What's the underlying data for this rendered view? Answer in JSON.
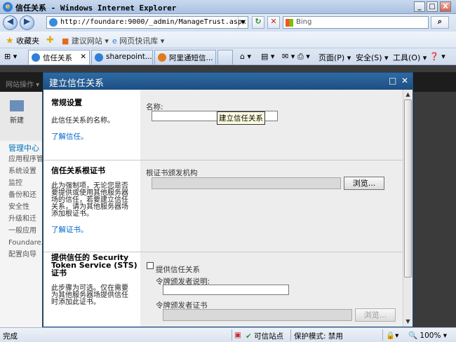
{
  "window": {
    "title": "信任关系 - Windows Internet Explorer",
    "minimize": "_",
    "restore": "□",
    "close": "X"
  },
  "addressbar": {
    "back": "◀",
    "forward": "▶",
    "url": "http://foundare:9000/_admin/ManageTrust.aspx",
    "refresh": "↻",
    "stop": "✕",
    "search_placeholder": "Bing",
    "search_go": "⌕"
  },
  "favorites": {
    "label": "收藏夹",
    "items": [
      "建议网站 ▾",
      "网页快讯库 ▾"
    ]
  },
  "tabs": {
    "items": [
      {
        "label": "信任关系",
        "close": "✕"
      },
      {
        "label": "sharepoint..."
      },
      {
        "label": "阿里通短信..."
      }
    ]
  },
  "commandbar": {
    "home": "⌂ ▾",
    "feeds": "▤ ▾",
    "mail": "✉ ▾",
    "print": "⎙ ▾",
    "page": "页面(P) ▾",
    "safety": "安全(S) ▾",
    "tools": "工具(O) ▾",
    "help": "❓ ▾"
  },
  "sharepoint": {
    "site_actions": "网站操作 ▾",
    "ribbon_new": "新建",
    "left_nav": [
      "管理中心",
      "应用程序管",
      "系统设置",
      "监控",
      "备份和还",
      "安全性",
      "升级和迁",
      "一般应用",
      "Foundare工",
      "配置向导"
    ]
  },
  "dialog": {
    "title": "建立信任关系",
    "maximize": "□",
    "close": "✕",
    "tooltip": "建立信任关系",
    "sections": [
      {
        "title": "常规设置",
        "description": "此信任关系的名称。",
        "link": "了解信任。",
        "field_label": "名称:",
        "field_value": ""
      },
      {
        "title": "信任关系根证书",
        "description": "此为强制项，无论您是否要提供或使用其他服务器场的信任，若要建立信任关系，请为其他服务器场添加根证书。",
        "link": "了解证书。",
        "field_label": "根证书颁发机构",
        "browse": "浏览..."
      },
      {
        "title": "提供信任的 Security Token Service (STS) 证书",
        "description": "此步骤为可选。仅在需要为其他服务器场提供信任时添加此证书。",
        "checkbox_label": "提供信任关系",
        "checkbox_checked": false,
        "issuer_desc_label": "令牌颁发者说明:",
        "issuer_cert_label": "令牌颁发者证书",
        "browse": "浏览..."
      }
    ]
  },
  "status": {
    "text": "完成",
    "zone": "可信站点",
    "protected_mode": "保护模式: 禁用",
    "zoom": "100%"
  }
}
